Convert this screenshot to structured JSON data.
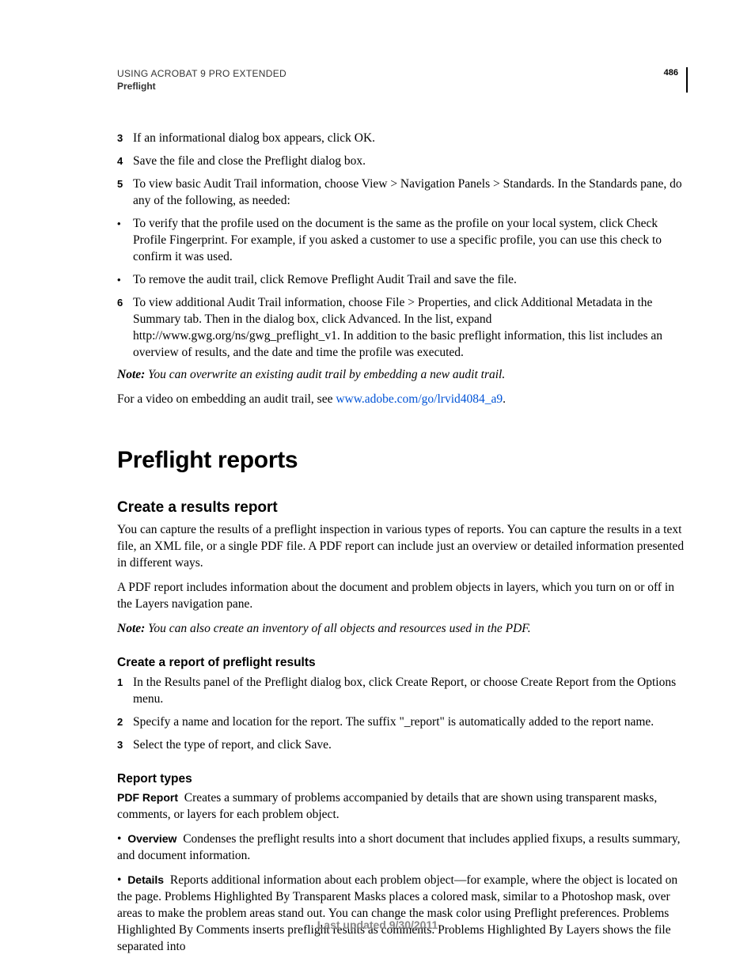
{
  "header": {
    "product": "USING ACROBAT 9 PRO EXTENDED",
    "section": "Preflight",
    "page": "486"
  },
  "steps_a": [
    {
      "n": "3",
      "t": "If an informational dialog box appears, click OK."
    },
    {
      "n": "4",
      "t": "Save the file and close the Preflight dialog box."
    },
    {
      "n": "5",
      "t": "To view basic Audit Trail information, choose View > Navigation Panels > Standards. In the Standards pane, do any of the following, as needed:"
    }
  ],
  "bullets_a": [
    "To verify that the profile used on the document is the same as the profile on your local system, click Check Profile Fingerprint. For example, if you asked a customer to use a specific profile, you can use this check to confirm it was used.",
    "To remove the audit trail, click Remove Preflight Audit Trail and save the file."
  ],
  "steps_b": [
    {
      "n": "6",
      "t": "To view additional Audit Trail information, choose File > Properties, and click Additional Metadata in the Summary tab. Then in the dialog box, click Advanced. In the list, expand http://www.gwg.org/ns/gwg_preflight_v1. In addition to the basic preflight information, this list includes an overview of results, and the date and time the profile was executed."
    }
  ],
  "note1": {
    "label": "Note: ",
    "text": "You can overwrite an existing audit trail by embedding a new audit trail."
  },
  "para1_prefix": "For a video on embedding an audit trail, see ",
  "para1_link": "www.adobe.com/go/lrvid4084_a9",
  "para1_suffix": ".",
  "h1": "Preflight reports",
  "h2a": "Create a results report",
  "para2": "You can capture the results of a preflight inspection in various types of reports. You can capture the results in a text file, an XML file, or a single PDF file. A PDF report can include just an overview or detailed information presented in different ways.",
  "para3": "A PDF report includes information about the document and problem objects in layers, which you turn on or off in the Layers navigation pane.",
  "note2": {
    "label": "Note: ",
    "text": "You can also create an inventory of all objects and resources used in the PDF."
  },
  "h3a": "Create a report of preflight results",
  "steps_c": [
    {
      "n": "1",
      "t": "In the Results panel of the Preflight dialog box, click Create Report, or choose Create Report from the Options menu."
    },
    {
      "n": "2",
      "t": "Specify a name and location for the report. The suffix \"_report\" is automatically added to the report name."
    },
    {
      "n": "3",
      "t": "Select the type of report, and click Save."
    }
  ],
  "h3b": "Report types",
  "pdfreport": {
    "label": "PDF Report",
    "text": "Creates a summary of problems accompanied by details that are shown using transparent masks, comments, or layers for each problem object."
  },
  "overview": {
    "label": "Overview",
    "text": "Condenses the preflight results into a short document that includes applied fixups, a results summary, and document information."
  },
  "details": {
    "label": "Details",
    "text": "Reports additional information about each problem object—for example, where the object is located on the page. Problems Highlighted By Transparent Masks places a colored mask, similar to a Photoshop mask, over areas to make the problem areas stand out. You can change the mask color using Preflight preferences. Problems Highlighted By Comments inserts preflight results as comments. Problems Highlighted By Layers shows the file separated into"
  },
  "footer": "Last updated 9/30/2011"
}
